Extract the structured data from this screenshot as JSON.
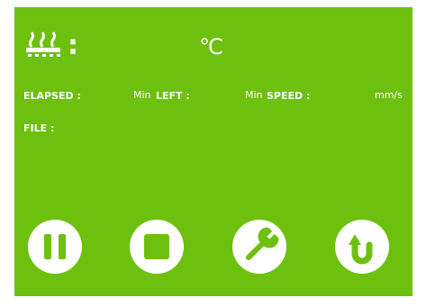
{
  "status": {
    "temp_unit": "℃",
    "elapsed_label": "ELAPSED :",
    "elapsed_unit": "Min",
    "left_label": "LEFT :",
    "left_unit": "Min",
    "speed_label": "SPEED :",
    "speed_unit": "mm/s",
    "file_label": "FILE :"
  },
  "header": {
    "heater_separator": ":"
  },
  "colors": {
    "background": "#6ec00e",
    "foreground": "#ffffff"
  },
  "buttons": [
    {
      "name": "pause",
      "icon": "pause-icon"
    },
    {
      "name": "stop",
      "icon": "stop-icon"
    },
    {
      "name": "settings",
      "icon": "wrench-icon"
    },
    {
      "name": "back",
      "icon": "u-turn-arrow-icon"
    }
  ]
}
